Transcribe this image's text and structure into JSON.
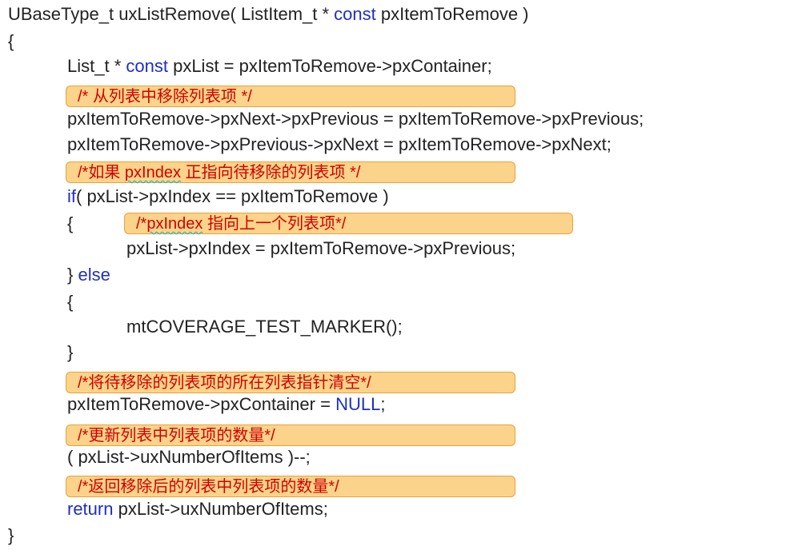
{
  "code": {
    "signature": [
      "UBaseType_t uxListRemove( ListItem_t * ",
      "const",
      " pxItemToRemove )"
    ],
    "open_brace": "{",
    "l1": [
      "List_t * ",
      "const",
      " pxList = pxItemToRemove->pxContainer;"
    ],
    "c1": "/* 从列表中移除列表项 */",
    "l2": "pxItemToRemove->pxNext->pxPrevious = pxItemToRemove->pxPrevious;",
    "l3": "pxItemToRemove->pxPrevious->pxNext = pxItemToRemove->pxNext;",
    "c2": [
      "/*如果 ",
      "pxIndex",
      " 正指向待移除的列表项 */"
    ],
    "l4": [
      "if",
      "( pxList->pxIndex == pxItemToRemove )"
    ],
    "l5_brace": "{",
    "c3": [
      "/*",
      "pxIndex",
      " 指向上一个列表项*/"
    ],
    "l6": "pxList->pxIndex = pxItemToRemove->pxPrevious;",
    "l7": [
      "} ",
      "else"
    ],
    "l8_brace": "{",
    "l9": "mtCOVERAGE_TEST_MARKER();",
    "l10_brace": "}",
    "c4": "/*将待移除的列表项的所在列表指针清空*/",
    "l11": [
      "pxItemToRemove->pxContainer = ",
      "NULL",
      ";"
    ],
    "c5": "/*更新列表中列表项的数量*/",
    "l12": "( pxList->uxNumberOfItems )--;",
    "c6": "/*返回移除后的列表中列表项的数量*/",
    "l13": [
      "return",
      " pxList->uxNumberOfItems;"
    ],
    "close_brace": "}"
  }
}
